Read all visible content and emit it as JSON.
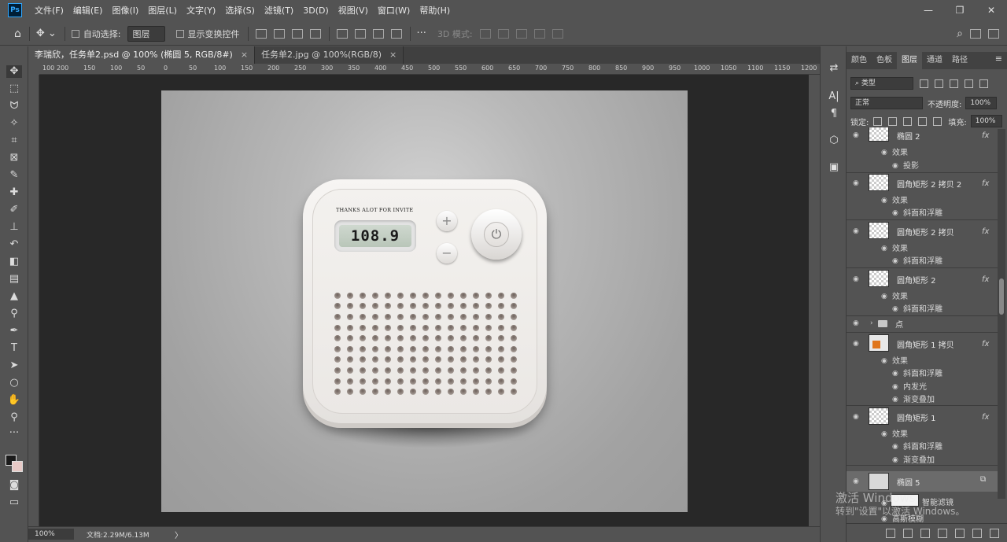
{
  "app": {
    "logo": "Ps"
  },
  "menu": [
    "文件(F)",
    "编辑(E)",
    "图像(I)",
    "图层(L)",
    "文字(Y)",
    "选择(S)",
    "滤镜(T)",
    "3D(D)",
    "视图(V)",
    "窗口(W)",
    "帮助(H)"
  ],
  "window_controls": {
    "minimize": "—",
    "restore": "❐",
    "close": "✕"
  },
  "options": {
    "auto_select_label": "自动选择:",
    "auto_select_value": "图层",
    "show_transform_label": "显示变换控件",
    "mode_3d_label": "3D 模式:",
    "more": "···"
  },
  "tabs": [
    {
      "label": "李瑞欣，任务单2.psd @ 100% (椭圆 5, RGB/8#)",
      "close": "×"
    },
    {
      "label": "任务单2.jpg @ 100%(RGB/8)",
      "close": "×"
    }
  ],
  "ruler_ticks": [
    "100",
    "200",
    "150",
    "100",
    "50",
    "0",
    "50",
    "100",
    "150",
    "200",
    "250",
    "300",
    "350",
    "400",
    "450",
    "500",
    "550",
    "600",
    "650",
    "700",
    "750",
    "800",
    "850",
    "900",
    "950",
    "1000",
    "1050",
    "1100",
    "1150",
    "1200"
  ],
  "artwork": {
    "brand_text": "THANKS ALOT FOR INVITE",
    "lcd_value": "108.9",
    "plus": "+",
    "minus": "−",
    "power": "⏻"
  },
  "status": {
    "zoom": "100%",
    "doc_info": "文档:2.29M/6.13M",
    "arrow": "〉"
  },
  "panel": {
    "tabs": [
      "颜色",
      "色板",
      "图层",
      "通道",
      "路径"
    ],
    "active_tab": "图层",
    "menu_icon": "≡",
    "filter_type": "类型",
    "blend_mode": "正常",
    "opacity_label": "不透明度:",
    "opacity_value": "100%",
    "lock_label": "锁定:",
    "fill_label": "填充:",
    "fill_value": "100%"
  },
  "layers": {
    "l1": {
      "name": "椭圆 2",
      "fx": "fx",
      "effects": "效果",
      "e1": "投影"
    },
    "l2": {
      "name": "圆角矩形 2 拷贝 2",
      "fx": "fx",
      "effects": "效果",
      "e1": "斜面和浮雕"
    },
    "l3": {
      "name": "圆角矩形 2 拷贝",
      "fx": "fx",
      "effects": "效果",
      "e1": "斜面和浮雕"
    },
    "l4": {
      "name": "圆角矩形 2",
      "fx": "fx",
      "effects": "效果",
      "e1": "斜面和浮雕"
    },
    "group": {
      "name": "点"
    },
    "l5": {
      "name": "圆角矩形 1 拷贝",
      "fx": "fx",
      "effects": "效果",
      "e1": "斜面和浮雕",
      "e2": "内发光",
      "e3": "渐变叠加"
    },
    "l6": {
      "name": "圆角矩形 1",
      "fx": "fx",
      "effects": "效果",
      "e1": "斜面和浮雕",
      "e2": "渐变叠加"
    },
    "l7": {
      "name": "椭圆 5",
      "smart_filters": "智能滤镜",
      "e1": "高斯模糊"
    }
  },
  "watermark": {
    "line1": "激活 Windows",
    "line2": "转到\"设置\"以激活 Windows。"
  }
}
